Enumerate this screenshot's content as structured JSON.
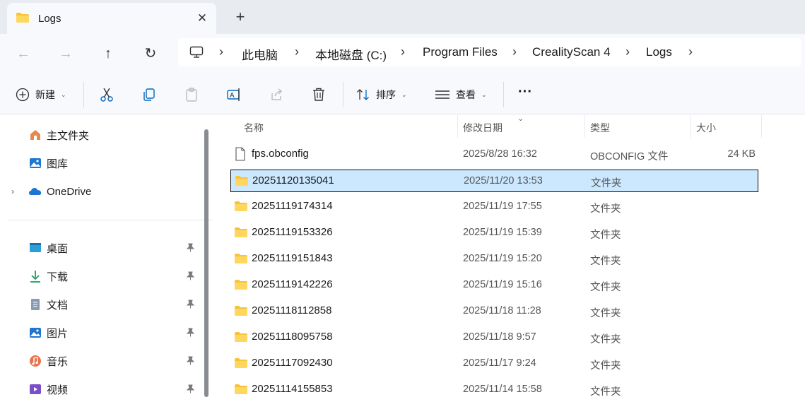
{
  "tab": {
    "title": "Logs",
    "close": "✕",
    "new_tab": "+"
  },
  "nav": {
    "back": "←",
    "forward": "→",
    "up": "↑",
    "refresh": "↻"
  },
  "breadcrumb": [
    {
      "label": "此电脑"
    },
    {
      "label": "本地磁盘 (C:)"
    },
    {
      "label": "Program Files"
    },
    {
      "label": "CrealityScan 4"
    },
    {
      "label": "Logs"
    }
  ],
  "commands": {
    "new": "新建",
    "sort": "排序",
    "view": "查看",
    "more": "···"
  },
  "sidebar": {
    "items": [
      {
        "label": "主文件夹",
        "icon": "home-icon"
      },
      {
        "label": "图库",
        "icon": "gallery-icon"
      },
      {
        "label": "OneDrive",
        "icon": "onedrive-icon"
      }
    ],
    "pinned": [
      {
        "label": "桌面",
        "icon": "desktop-icon"
      },
      {
        "label": "下载",
        "icon": "download-icon"
      },
      {
        "label": "文档",
        "icon": "document-icon"
      },
      {
        "label": "图片",
        "icon": "pictures-icon"
      },
      {
        "label": "音乐",
        "icon": "music-icon"
      },
      {
        "label": "视频",
        "icon": "video-icon"
      }
    ],
    "expand": "›",
    "pin": "📌"
  },
  "columns": {
    "name": "名称",
    "date": "修改日期",
    "type": "类型",
    "size": "大小"
  },
  "files": [
    {
      "name": "fps.obconfig",
      "date": "2025/8/28 16:32",
      "type": "OBCONFIG 文件",
      "size": "24 KB",
      "kind": "file"
    },
    {
      "name": "20251120135041",
      "date": "2025/11/20 13:53",
      "type": "文件夹",
      "size": "",
      "kind": "folder"
    },
    {
      "name": "20251119174314",
      "date": "2025/11/19 17:55",
      "type": "文件夹",
      "size": "",
      "kind": "folder"
    },
    {
      "name": "20251119153326",
      "date": "2025/11/19 15:39",
      "type": "文件夹",
      "size": "",
      "kind": "folder"
    },
    {
      "name": "20251119151843",
      "date": "2025/11/19 15:20",
      "type": "文件夹",
      "size": "",
      "kind": "folder"
    },
    {
      "name": "20251119142226",
      "date": "2025/11/19 15:16",
      "type": "文件夹",
      "size": "",
      "kind": "folder"
    },
    {
      "name": "20251118112858",
      "date": "2025/11/18 11:28",
      "type": "文件夹",
      "size": "",
      "kind": "folder"
    },
    {
      "name": "20251118095758",
      "date": "2025/11/18 9:57",
      "type": "文件夹",
      "size": "",
      "kind": "folder"
    },
    {
      "name": "20251117092430",
      "date": "2025/11/17 9:24",
      "type": "文件夹",
      "size": "",
      "kind": "folder"
    },
    {
      "name": "20251114155853",
      "date": "2025/11/14 15:58",
      "type": "文件夹",
      "size": "",
      "kind": "folder"
    }
  ],
  "selected_index": 1,
  "colors": {
    "selection": "#cce8ff",
    "folder": "#f8c33a",
    "accent": "#0067c0"
  }
}
